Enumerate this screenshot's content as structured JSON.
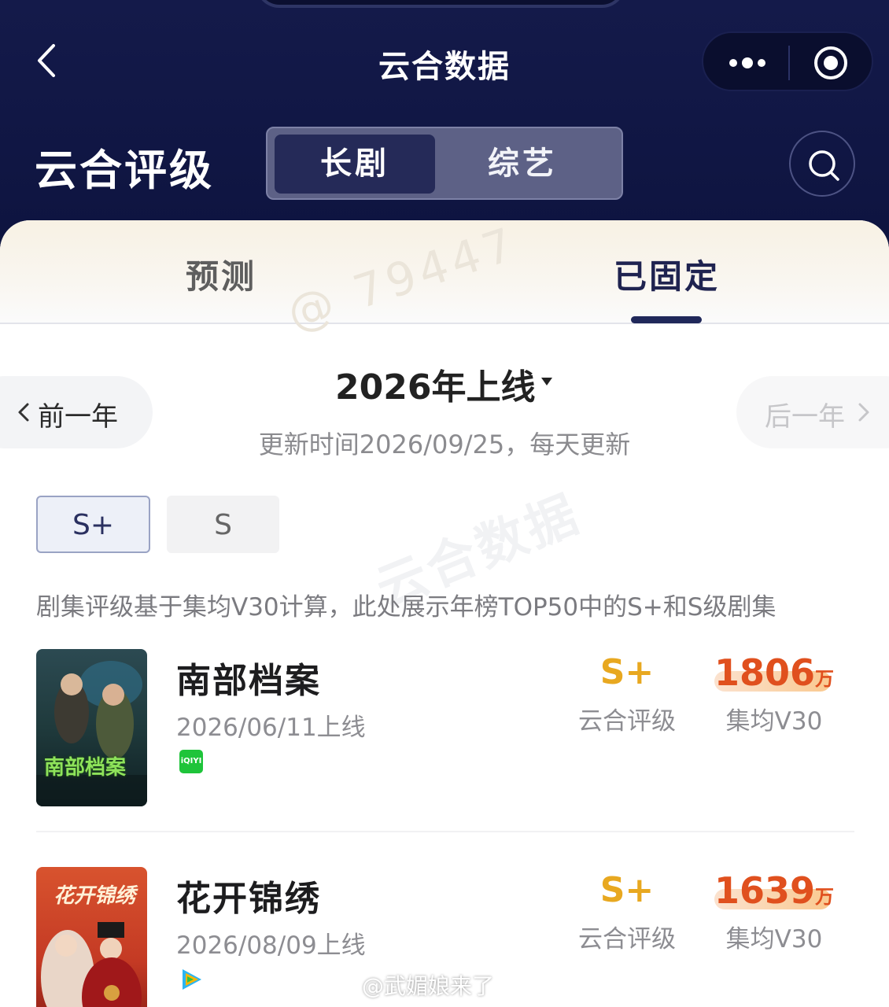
{
  "header": {
    "app_title": "云合数据",
    "section_title": "云合评级",
    "segment": {
      "active": "长剧",
      "inactive": "综艺"
    },
    "icons": [
      "back-chevron-icon",
      "more-dots-icon",
      "target-circle-icon",
      "search-icon"
    ]
  },
  "tabs": {
    "predict": "预测",
    "fixed": "已固定",
    "active": "已固定"
  },
  "watermark": {
    "top": "@ 79447",
    "mid": "云合数据"
  },
  "year_nav": {
    "prev": "前一年",
    "next": "后一年",
    "title": "2026年上线",
    "update": "更新时间2026/09/25，每天更新"
  },
  "levels": {
    "splus": "S+",
    "s": "S",
    "active": "S+"
  },
  "note": "剧集评级基于集均V30计算，此处展示年榜TOP50中的S+和S级剧集",
  "dramas": [
    {
      "poster_text": "南部档案",
      "title": "南部档案",
      "date": "2026/06/11上线",
      "platform": "iQIYI",
      "rating": "S+",
      "rating_label": "云合评级",
      "score": "1806",
      "score_unit": "万",
      "score_label": "集均V30"
    },
    {
      "poster_text": "花开锦绣",
      "title": "花开锦绣",
      "date": "2026/08/09上线",
      "platform": "Tencent Video",
      "rating": "S+",
      "rating_label": "云合评级",
      "score": "1639",
      "score_unit": "万",
      "score_label": "集均V30"
    }
  ],
  "credit": "@武媚娘来了",
  "colors": {
    "header_bg": "#141a4a",
    "segment_active": "#252a58",
    "rating_gold": "#e8a820",
    "score_orange": "#e0501e",
    "iqiyi_green": "#1ec43a"
  }
}
